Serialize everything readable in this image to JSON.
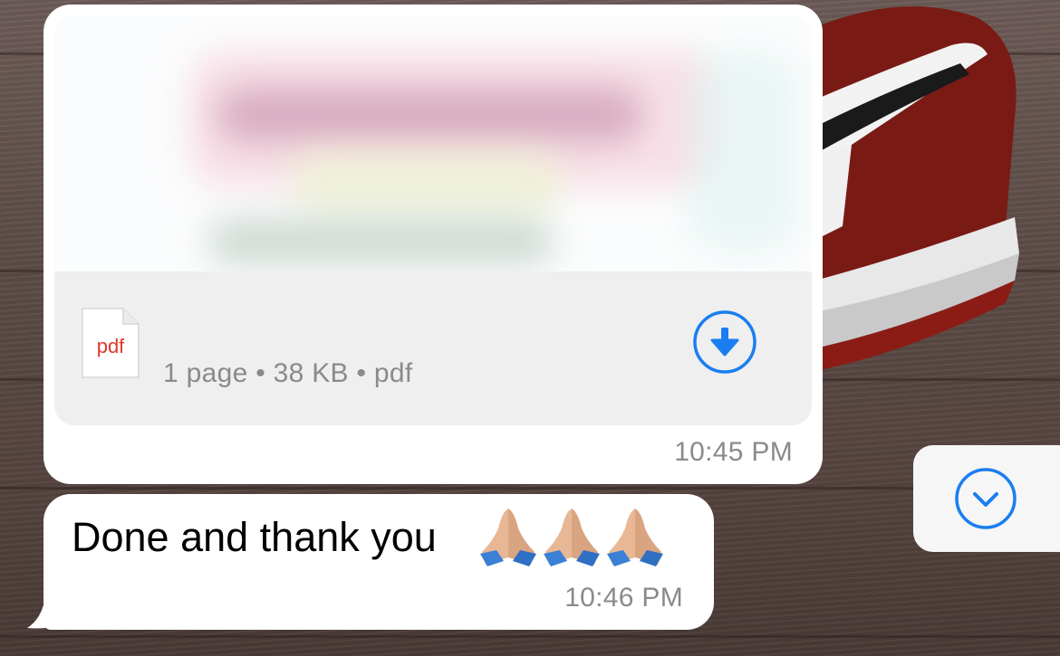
{
  "messages": [
    {
      "type": "document",
      "file": {
        "type_label": "pdf",
        "meta": "1 page • 38 KB • pdf"
      },
      "time": "10:45 PM",
      "download_icon": "download-arrow-icon"
    },
    {
      "type": "text",
      "text": "Done and thank you",
      "emoji": [
        "🙏🏼",
        "🙏🏼",
        "🙏🏼"
      ],
      "time": "10:46 PM"
    }
  ],
  "scroll_button": {
    "icon": "chevron-down-icon"
  },
  "colors": {
    "accent": "#1a7ef0",
    "bubble": "#ffffff",
    "file_panel": "#efefef",
    "meta_text": "#8a8a8e",
    "pdf_red": "#e0382c"
  }
}
